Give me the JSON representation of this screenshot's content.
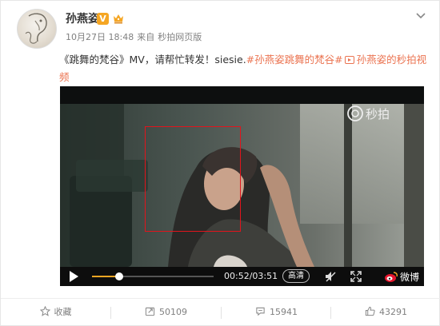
{
  "user": {
    "name": "孙燕姿",
    "verified_badge": "V",
    "post_time": "10月27日 18:48",
    "source_prefix": "来自",
    "source": "秒拍网页版"
  },
  "post": {
    "text_main": "《跳舞的梵谷》MV，请帮忙转发！siesie.",
    "hashtag": "#孙燕姿跳舞的梵谷#",
    "video_link": "孙燕姿的秒拍视频"
  },
  "player": {
    "watermark": "秒拍",
    "time_current": "00:52",
    "time_total": "03:51",
    "time_display": "00:52/03:51",
    "quality_label": "高清",
    "weibo_label": "微博",
    "progress_fraction": 0.225
  },
  "actions": {
    "favorite_label": "收藏",
    "repost_count": "50109",
    "comment_count": "15941",
    "like_count": "43291"
  },
  "colors": {
    "link": "#eb7350",
    "highlight_box": "#e2141c",
    "badge": "#f5a623"
  }
}
